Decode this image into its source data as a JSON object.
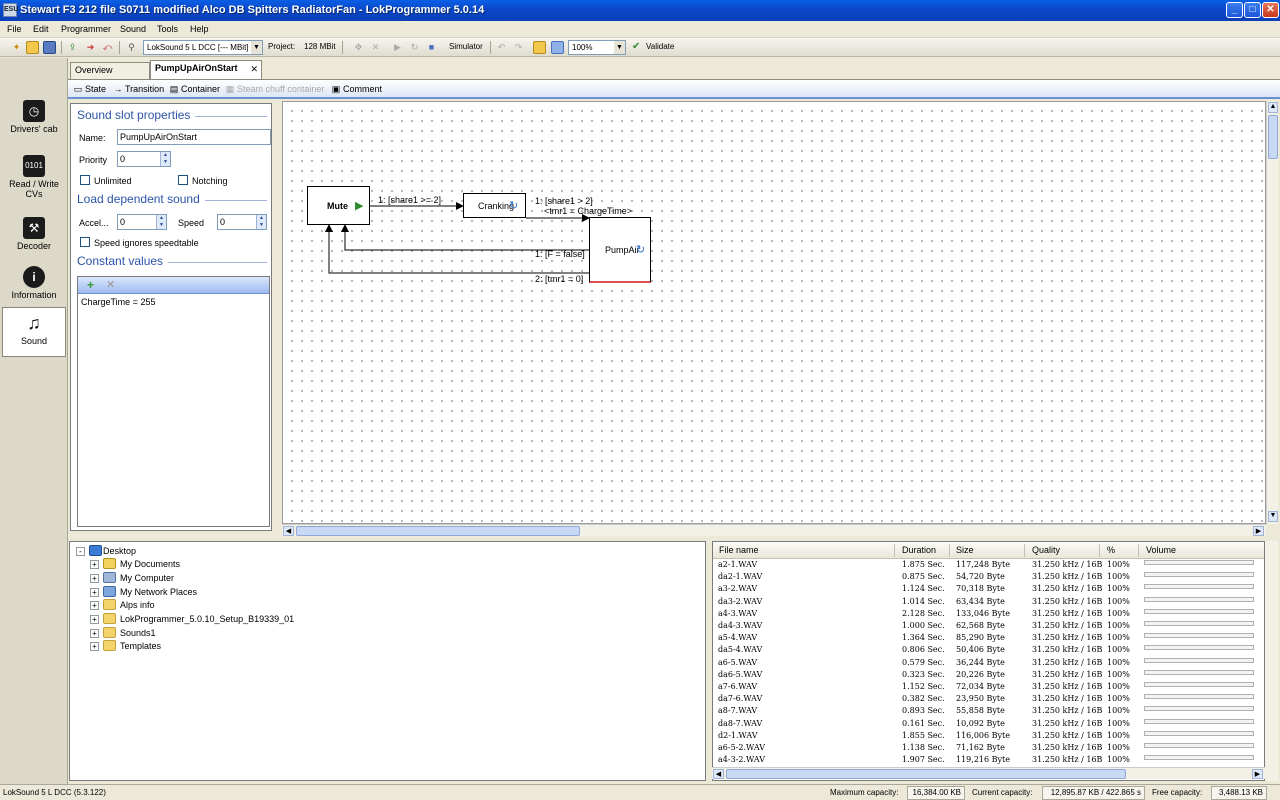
{
  "window": {
    "title": "Stewart F3 212 file S0711 modified Alco DB Spitters RadiatorFan - LokProgrammer 5.0.14",
    "buttons": {
      "minimize": "_",
      "maximize": "□",
      "close": "✕"
    }
  },
  "menu": [
    "File",
    "Edit",
    "Programmer",
    "Sound",
    "Tools",
    "Help"
  ],
  "toolbar": {
    "decoder_select": "LokSound 5 L DCC [--- MBit]",
    "project_label": "Project:",
    "project_size": "128 MBit",
    "simulator_label": "Simulator",
    "zoom_value": "100%",
    "validate_label": "Validate"
  },
  "leftnav": [
    {
      "label": "Drivers' cab",
      "icon": "drivers-cab-icon"
    },
    {
      "label": "Read / Write CVs",
      "icon": "read-write-cvs-icon"
    },
    {
      "label": "Decoder",
      "icon": "decoder-icon"
    },
    {
      "label": "Information",
      "icon": "information-icon"
    },
    {
      "label": "Sound",
      "icon": "sound-icon"
    }
  ],
  "tabs": {
    "overview": "Overview",
    "active": "PumpUpAirOnStart",
    "close": "✕"
  },
  "editor_toolbar": {
    "state": "State",
    "transition": "Transition",
    "container": "Container",
    "steam_chuff": "Steam chuff container",
    "comment": "Comment"
  },
  "properties": {
    "slot_title": "Sound slot properties",
    "name_label": "Name:",
    "name_value": "PumpUpAirOnStart",
    "priority_label": "Priority",
    "priority_value": "0",
    "unlimited_label": "Unlimited",
    "notching_label": "Notching",
    "load_title": "Load dependent sound",
    "accel_label": "Accel...",
    "accel_value": "0",
    "speed_label": "Speed",
    "speed_value": "0",
    "speed_ignores_label": "Speed ignores speedtable",
    "constant_title": "Constant values",
    "constant_entry": "ChargeTime = 255"
  },
  "diagram": {
    "states": {
      "mute": "Mute",
      "cranking": "Cranking",
      "pumpair": "PumpAir"
    },
    "transitions": {
      "t1": "1: [share1 >= 2]",
      "t2_line1": "1: [share1 > 2]",
      "t2_line2": "<tmr1 = ChargeTime>",
      "t3": "1: [F = false]",
      "t4": "2: [tmr1 = 0]"
    }
  },
  "tree": [
    {
      "label": "Desktop",
      "icon": "desktop-icon",
      "exp": "-"
    },
    {
      "label": "My Documents",
      "icon": "documents-icon",
      "exp": "+"
    },
    {
      "label": "My Computer",
      "icon": "computer-icon",
      "exp": "+"
    },
    {
      "label": "My Network Places",
      "icon": "network-icon",
      "exp": "+"
    },
    {
      "label": "Alps info",
      "icon": "folder-icon",
      "exp": "+"
    },
    {
      "label": "LokProgrammer_5.0.10_Setup_B19339_01",
      "icon": "folder-icon",
      "exp": "+"
    },
    {
      "label": "Sounds1",
      "icon": "folder-icon",
      "exp": "+"
    },
    {
      "label": "Templates",
      "icon": "folder-icon",
      "exp": "+"
    }
  ],
  "filelist": {
    "headers": {
      "file_name": "File name",
      "duration": "Duration",
      "size": "Size",
      "quality": "Quality",
      "percent": "%",
      "volume": "Volume"
    },
    "rows": [
      {
        "name": "a2-1.WAV",
        "duration": "1.875 Sec.",
        "size": "117,248 Byte",
        "quality": "31.250 kHz / 16B",
        "pct": "100%"
      },
      {
        "name": "da2-1.WAV",
        "duration": "0.875 Sec.",
        "size": "54,720 Byte",
        "quality": "31.250 kHz / 16B",
        "pct": "100%"
      },
      {
        "name": "a3-2.WAV",
        "duration": "1.124 Sec.",
        "size": "70,318 Byte",
        "quality": "31.250 kHz / 16B",
        "pct": "100%"
      },
      {
        "name": "da3-2.WAV",
        "duration": "1.014 Sec.",
        "size": "63,434 Byte",
        "quality": "31.250 kHz / 16B",
        "pct": "100%"
      },
      {
        "name": "a4-3.WAV",
        "duration": "2.128 Sec.",
        "size": "133,046 Byte",
        "quality": "31.250 kHz / 16B",
        "pct": "100%"
      },
      {
        "name": "da4-3.WAV",
        "duration": "1.000 Sec.",
        "size": "62,568 Byte",
        "quality": "31.250 kHz / 16B",
        "pct": "100%"
      },
      {
        "name": "a5-4.WAV",
        "duration": "1.364 Sec.",
        "size": "85,290 Byte",
        "quality": "31.250 kHz / 16B",
        "pct": "100%"
      },
      {
        "name": "da5-4.WAV",
        "duration": "0.806 Sec.",
        "size": "50,406 Byte",
        "quality": "31.250 kHz / 16B",
        "pct": "100%"
      },
      {
        "name": "a6-5.WAV",
        "duration": "0.579 Sec.",
        "size": "36,244 Byte",
        "quality": "31.250 kHz / 16B",
        "pct": "100%"
      },
      {
        "name": "da6-5.WAV",
        "duration": "0.323 Sec.",
        "size": "20,226 Byte",
        "quality": "31.250 kHz / 16B",
        "pct": "100%"
      },
      {
        "name": "a7-6.WAV",
        "duration": "1.152 Sec.",
        "size": "72,034 Byte",
        "quality": "31.250 kHz / 16B",
        "pct": "100%"
      },
      {
        "name": "da7-6.WAV",
        "duration": "0.382 Sec.",
        "size": "23,950 Byte",
        "quality": "31.250 kHz / 16B",
        "pct": "100%"
      },
      {
        "name": "a8-7.WAV",
        "duration": "0.893 Sec.",
        "size": "55,858 Byte",
        "quality": "31.250 kHz / 16B",
        "pct": "100%"
      },
      {
        "name": "da8-7.WAV",
        "duration": "0.161 Sec.",
        "size": "10,092 Byte",
        "quality": "31.250 kHz / 16B",
        "pct": "100%"
      },
      {
        "name": "d2-1.WAV",
        "duration": "1.855 Sec.",
        "size": "116,006 Byte",
        "quality": "31.250 kHz / 16B",
        "pct": "100%"
      },
      {
        "name": "a6-5-2.WAV",
        "duration": "1.138 Sec.",
        "size": "71,162 Byte",
        "quality": "31.250 kHz / 16B",
        "pct": "100%"
      },
      {
        "name": "a4-3-2.WAV",
        "duration": "1.907 Sec.",
        "size": "119,216 Byte",
        "quality": "31.250 kHz / 16B",
        "pct": "100%"
      }
    ]
  },
  "statusbar": {
    "decoder": "LokSound 5 L DCC (5.3.122)",
    "max_label": "Maximum capacity:",
    "max_value": "16,384.00 KB",
    "current_label": "Current capacity:",
    "current_value": "12,895.87 KB / 422.865 s",
    "free_label": "Free capacity:",
    "free_value": "3,488.13 KB"
  },
  "colors": {
    "accent": "#2b55a8",
    "titlebar": "#0a47c8",
    "selection": "#9ebaf0"
  }
}
